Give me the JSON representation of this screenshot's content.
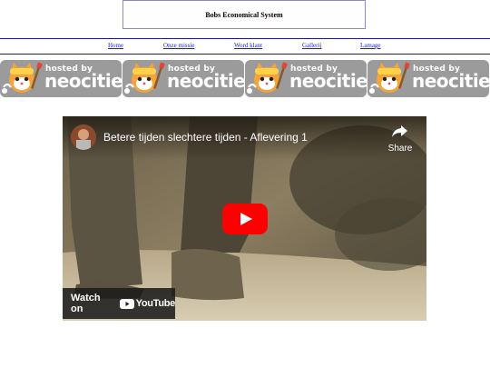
{
  "header": {
    "title": "Bobs Economical System"
  },
  "nav": {
    "items": [
      {
        "label": "Home"
      },
      {
        "label": "Onze missie"
      },
      {
        "label": "Word klant"
      },
      {
        "label": "Gallerij"
      },
      {
        "label": "Lamage"
      }
    ]
  },
  "banners": {
    "hosted_text": "hosted by",
    "brand_text": "neocities",
    "count": 4
  },
  "video": {
    "title": "Betere tijden slechtere tijden - Aflevering 1",
    "share_label": "Share",
    "watch_on_label": "Watch on",
    "youtube_label": "YouTube"
  },
  "colors": {
    "nav_link": "#1a1aee",
    "rule": "#1a1aa0",
    "banner_bg": "#9b9b9b",
    "youtube_red": "#ff0000"
  }
}
